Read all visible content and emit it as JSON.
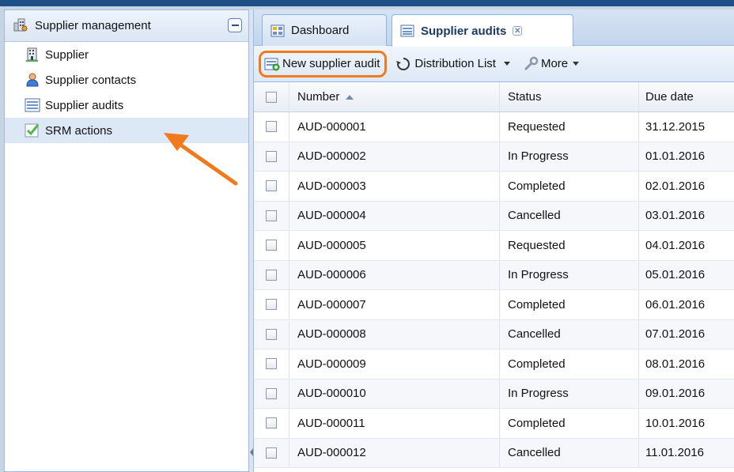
{
  "sidebar": {
    "title": "Supplier management",
    "items": [
      {
        "label": "Supplier",
        "icon": "building-icon"
      },
      {
        "label": "Supplier contacts",
        "icon": "person-icon"
      },
      {
        "label": "Supplier audits",
        "icon": "list-icon"
      },
      {
        "label": "SRM actions",
        "icon": "checkmark-icon",
        "selected": true
      }
    ]
  },
  "tabs": [
    {
      "label": "Dashboard",
      "active": false
    },
    {
      "label": "Supplier audits",
      "active": true
    }
  ],
  "toolbar": {
    "new_label": "New supplier audit",
    "distribution_label": "Distribution List",
    "more_label": "More"
  },
  "grid": {
    "columns": [
      "Number",
      "Status",
      "Due date"
    ],
    "rows": [
      {
        "number": "AUD-000001",
        "status": "Requested",
        "due": "31.12.2015"
      },
      {
        "number": "AUD-000002",
        "status": "In Progress",
        "due": "01.01.2016"
      },
      {
        "number": "AUD-000003",
        "status": "Completed",
        "due": "02.01.2016"
      },
      {
        "number": "AUD-000004",
        "status": "Cancelled",
        "due": "03.01.2016"
      },
      {
        "number": "AUD-000005",
        "status": "Requested",
        "due": "04.01.2016"
      },
      {
        "number": "AUD-000006",
        "status": "In Progress",
        "due": "05.01.2016"
      },
      {
        "number": "AUD-000007",
        "status": "Completed",
        "due": "06.01.2016"
      },
      {
        "number": "AUD-000008",
        "status": "Cancelled",
        "due": "07.01.2016"
      },
      {
        "number": "AUD-000009",
        "status": "Completed",
        "due": "08.01.2016"
      },
      {
        "number": "AUD-000010",
        "status": "In Progress",
        "due": "09.01.2016"
      },
      {
        "number": "AUD-000011",
        "status": "Completed",
        "due": "10.01.2016"
      },
      {
        "number": "AUD-000012",
        "status": "Cancelled",
        "due": "11.01.2016"
      }
    ]
  },
  "colors": {
    "accent_highlight": "#f07a1c",
    "header_blue": "#1f4f87",
    "selected_row": "#dde8f7"
  }
}
